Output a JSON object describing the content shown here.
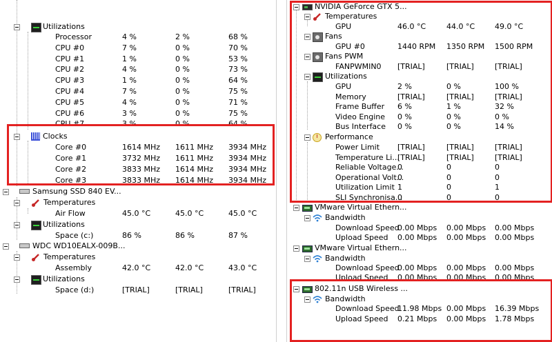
{
  "left": {
    "utilizations_label": "Utilizations",
    "cpu_rows": [
      {
        "name": "Processor",
        "v1": "4 %",
        "v2": "2 %",
        "v3": "68 %"
      },
      {
        "name": "CPU #0",
        "v1": "7 %",
        "v2": "0 %",
        "v3": "70 %"
      },
      {
        "name": "CPU #1",
        "v1": "1 %",
        "v2": "0 %",
        "v3": "53 %"
      },
      {
        "name": "CPU #2",
        "v1": "4 %",
        "v2": "0 %",
        "v3": "73 %"
      },
      {
        "name": "CPU #3",
        "v1": "1 %",
        "v2": "0 %",
        "v3": "64 %"
      },
      {
        "name": "CPU #4",
        "v1": "7 %",
        "v2": "0 %",
        "v3": "75 %"
      },
      {
        "name": "CPU #5",
        "v1": "4 %",
        "v2": "0 %",
        "v3": "71 %"
      },
      {
        "name": "CPU #6",
        "v1": "3 %",
        "v2": "0 %",
        "v3": "75 %"
      },
      {
        "name": "CPU #7",
        "v1": "3 %",
        "v2": "0 %",
        "v3": "64 %"
      }
    ],
    "clocks_label": "Clocks",
    "clock_rows": [
      {
        "name": "Core #0",
        "v1": "1614 MHz",
        "v2": "1611 MHz",
        "v3": "3934 MHz"
      },
      {
        "name": "Core #1",
        "v1": "3732 MHz",
        "v2": "1611 MHz",
        "v3": "3934 MHz"
      },
      {
        "name": "Core #2",
        "v1": "3833 MHz",
        "v2": "1614 MHz",
        "v3": "3934 MHz"
      },
      {
        "name": "Core #3",
        "v1": "3833 MHz",
        "v2": "1614 MHz",
        "v3": "3934 MHz"
      }
    ],
    "ssd": {
      "name": "Samsung SSD 840 EV...",
      "temperatures_label": "Temperatures",
      "airflow": {
        "name": "Air Flow",
        "v1": "45.0 °C",
        "v2": "45.0 °C",
        "v3": "45.0 °C"
      },
      "utilizations_label": "Utilizations",
      "space": {
        "name": "Space (c:)",
        "v1": "86 %",
        "v2": "86 %",
        "v3": "87 %"
      }
    },
    "wdc": {
      "name": "WDC WD10EALX-009B...",
      "temperatures_label": "Temperatures",
      "assembly": {
        "name": "Assembly",
        "v1": "42.0 °C",
        "v2": "42.0 °C",
        "v3": "43.0 °C"
      },
      "utilizations_label": "Utilizations",
      "space": {
        "name": "Space (d:)",
        "v1": "[TRIAL]",
        "v2": "[TRIAL]",
        "v3": "[TRIAL]"
      }
    }
  },
  "right": {
    "gpu_name": "NVIDIA GeForce GTX 5...",
    "temperatures_label": "Temperatures",
    "gpu_temp": {
      "name": "GPU",
      "v1": "46.0 °C",
      "v2": "44.0 °C",
      "v3": "49.0 °C"
    },
    "fans_label": "Fans",
    "fan_gpu0": {
      "name": "GPU #0",
      "v1": "1440 RPM",
      "v2": "1350 RPM",
      "v3": "1500 RPM"
    },
    "fanspwm_label": "Fans PWM",
    "fanpwmin0": {
      "name": "FANPWMIN0",
      "v1": "[TRIAL]",
      "v2": "[TRIAL]",
      "v3": "[TRIAL]"
    },
    "utilizations_label": "Utilizations",
    "util_rows": [
      {
        "name": "GPU",
        "v1": "2 %",
        "v2": "0 %",
        "v3": "100 %"
      },
      {
        "name": "Memory",
        "v1": "[TRIAL]",
        "v2": "[TRIAL]",
        "v3": "[TRIAL]"
      },
      {
        "name": "Frame Buffer",
        "v1": "6 %",
        "v2": "1 %",
        "v3": "32 %"
      },
      {
        "name": "Video Engine",
        "v1": "0 %",
        "v2": "0 %",
        "v3": "0 %"
      },
      {
        "name": "Bus Interface",
        "v1": "0 %",
        "v2": "0 %",
        "v3": "14 %"
      }
    ],
    "performance_label": "Performance",
    "perf_rows": [
      {
        "name": "Power Limit",
        "v1": "[TRIAL]",
        "v2": "[TRIAL]",
        "v3": "[TRIAL]"
      },
      {
        "name": "Temperature Li...",
        "v1": "[TRIAL]",
        "v2": "[TRIAL]",
        "v3": "[TRIAL]"
      },
      {
        "name": "Reliable Voltage...",
        "v1": "0",
        "v2": "0",
        "v3": "0"
      },
      {
        "name": "Operational Volt...",
        "v1": "0",
        "v2": "0",
        "v3": "0"
      },
      {
        "name": "Utilization Limit",
        "v1": "1",
        "v2": "0",
        "v3": "1"
      },
      {
        "name": "SLI Synchronisa...",
        "v1": "0",
        "v2": "0",
        "v3": "0"
      }
    ],
    "vm1": {
      "name": "VMware Virtual Ethern...",
      "bandwidth_label": "Bandwidth",
      "down": {
        "name": "Download Speed",
        "v1": "0.00 Mbps",
        "v2": "0.00 Mbps",
        "v3": "0.00 Mbps"
      },
      "up": {
        "name": "Upload Speed",
        "v1": "0.00 Mbps",
        "v2": "0.00 Mbps",
        "v3": "0.00 Mbps"
      }
    },
    "vm2": {
      "name": "VMware Virtual Ethern...",
      "bandwidth_label": "Bandwidth",
      "down": {
        "name": "Download Speed",
        "v1": "0.00 Mbps",
        "v2": "0.00 Mbps",
        "v3": "0.00 Mbps"
      },
      "up": {
        "name": "Upload Speed",
        "v1": "0.00 Mbps",
        "v2": "0.00 Mbps",
        "v3": "0.00 Mbps"
      }
    },
    "wifi": {
      "name": "802.11n USB Wireless ...",
      "bandwidth_label": "Bandwidth",
      "down": {
        "name": "Download Speed",
        "v1": "11.98 Mbps",
        "v2": "0.00 Mbps",
        "v3": "16.39 Mbps"
      },
      "up": {
        "name": "Upload Speed",
        "v1": "0.21 Mbps",
        "v2": "0.00 Mbps",
        "v3": "1.78 Mbps"
      }
    }
  },
  "colors": {
    "highlight_box": "#e32121",
    "tree_line": "#a0a0a0"
  }
}
